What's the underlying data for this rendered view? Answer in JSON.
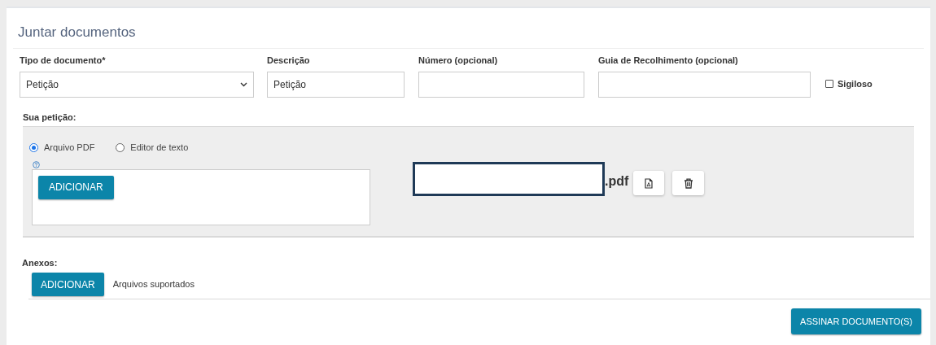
{
  "title": "Juntar documentos",
  "fields": [
    {
      "kind": "select",
      "label": "Tipo de documento*",
      "value": "Petição"
    },
    {
      "kind": "text",
      "label": "Descrição",
      "value": "Petição"
    },
    {
      "kind": "text",
      "label": "Número (opcional)"
    },
    {
      "kind": "text",
      "label": "Guia de Recolhimento (opcional)"
    }
  ],
  "sigiloso": {
    "label": "Sigiloso",
    "checked": false
  },
  "petition": {
    "label": "Sua petição:",
    "options": [
      {
        "label": "Arquivo PDF",
        "selected": true
      },
      {
        "label": "Editor de texto",
        "selected": false
      }
    ],
    "add_button": "ADICIONAR",
    "file_name": ".pdf"
  },
  "attachments": {
    "label": "Anexos:",
    "add_button": "ADICIONAR",
    "supported_link": "Arquivos suportados"
  },
  "sign_button": "ASSINAR DOCUMENTO(S)"
}
